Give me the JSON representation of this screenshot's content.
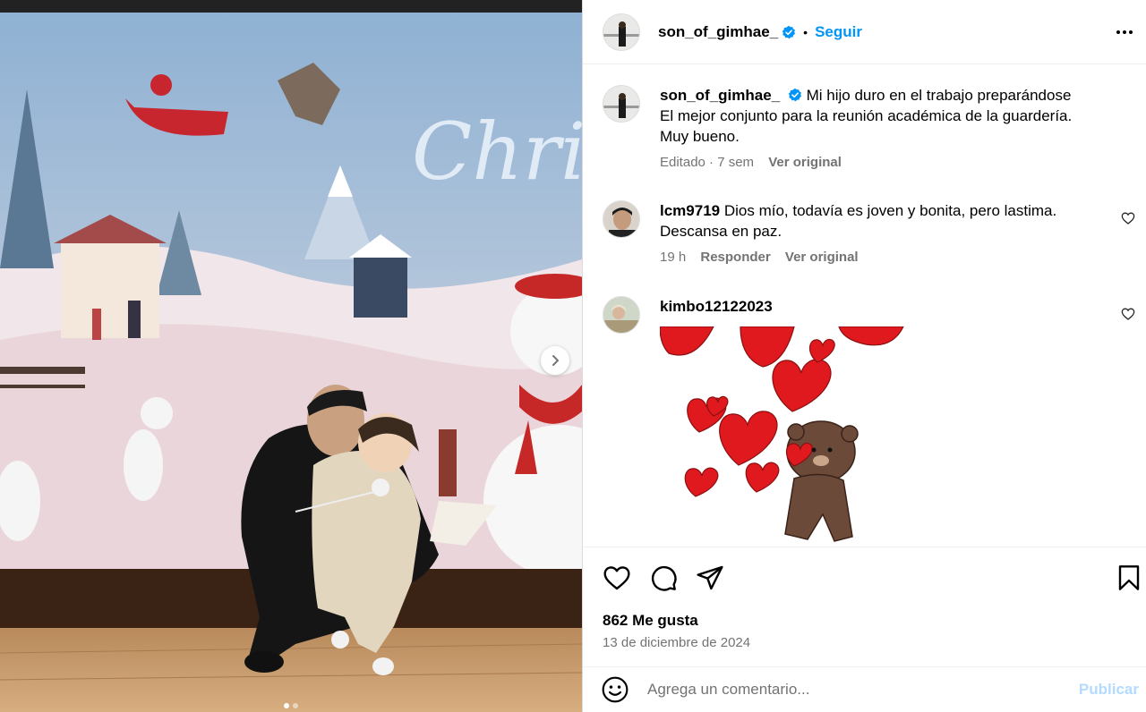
{
  "post": {
    "author": "son_of_gimhae_",
    "verified_icon": "verified-badge-icon",
    "follow_label": "Seguir",
    "separator": "•",
    "more_icon": "more-options-icon",
    "carousel": {
      "next_icon": "chevron-right-icon",
      "slide_count": 2,
      "active_slide": 0
    }
  },
  "caption": {
    "author": "son_of_gimhae_",
    "text_lines": [
      "Mi hijo duro en el trabajo preparándose",
      "El mejor conjunto para la reunión académica de la guardería.",
      "Muy bueno."
    ],
    "edited": "Editado · 7 sem",
    "translate": "Ver original"
  },
  "comments": [
    {
      "author": "lcm9719",
      "text_lines": [
        "Dios mío, todavía es joven y bonita, pero lastima.",
        "Descansa en paz."
      ],
      "time": "19 h",
      "reply": "Responder",
      "translate": "Ver original"
    },
    {
      "author": "kimbo12122023",
      "sticker": "hearts-bear-sticker"
    }
  ],
  "actions": {
    "like_icon": "heart-icon",
    "comment_icon": "comment-icon",
    "share_icon": "send-icon",
    "save_icon": "bookmark-icon",
    "likes": "862 Me gusta",
    "date": "13 de diciembre de 2024"
  },
  "composer": {
    "emoji_icon": "emoji-icon",
    "placeholder": "Agrega un comentario...",
    "publish_label": "Publicar"
  },
  "colors": {
    "link": "#0095f6",
    "publish_disabled": "#b3dbff",
    "muted": "#737373",
    "heart_red": "#e0191f"
  }
}
